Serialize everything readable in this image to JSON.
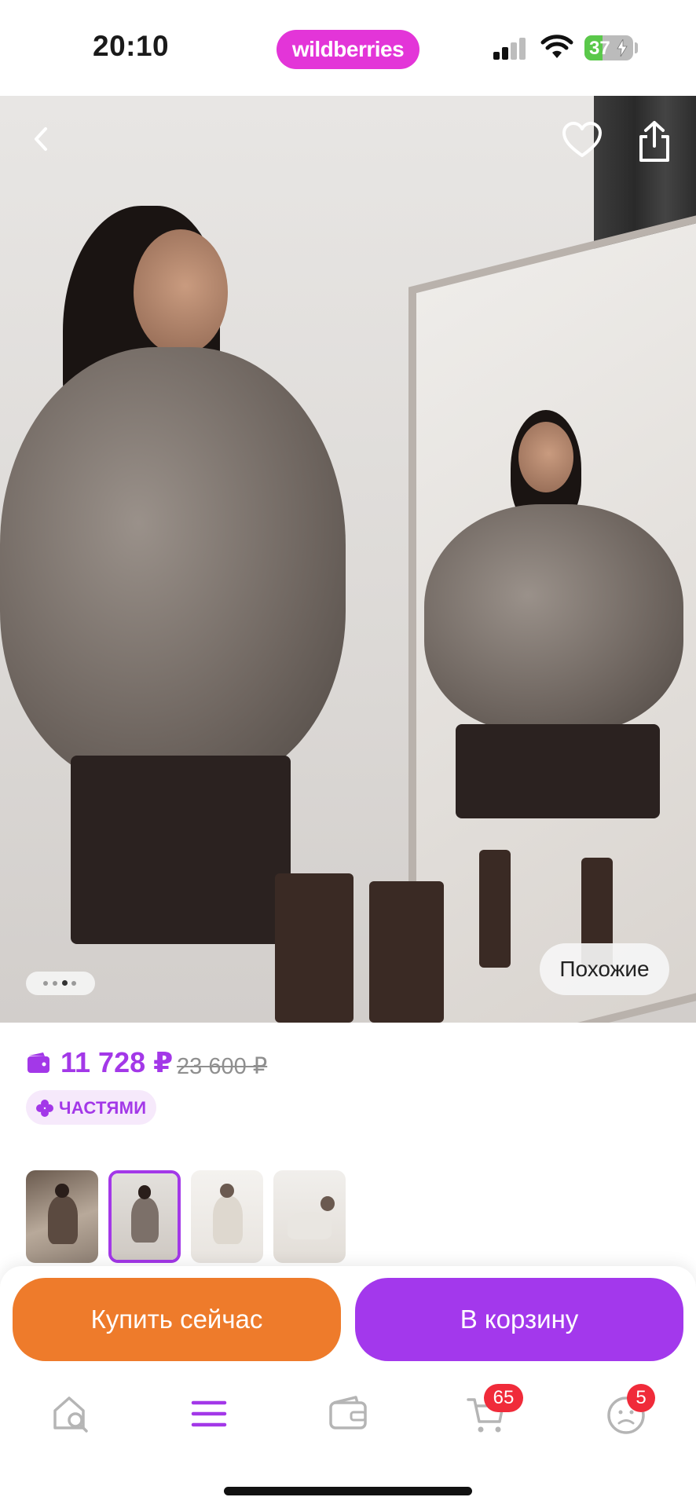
{
  "status_bar": {
    "time": "20:10",
    "brand": "wildberries",
    "battery_percent": "37",
    "battery_level": 0.37,
    "icons": [
      "signal-icon",
      "wifi-icon",
      "battery-charging-icon"
    ]
  },
  "hero": {
    "similar_label": "Похожие",
    "page_count": 4,
    "active_page": 2,
    "icons": [
      "back-icon",
      "heart-icon",
      "share-icon"
    ]
  },
  "product": {
    "price": "11 728 ₽",
    "old_price": "23 600 ₽",
    "installments_label": "ЧАСТЯМИ"
  },
  "thumbnails": {
    "count": 4,
    "selected_index": 1
  },
  "actions": {
    "buy_now": "Купить сейчас",
    "add_to_cart": "В корзину"
  },
  "tab_bar": {
    "items": [
      {
        "icon": "home-search-icon"
      },
      {
        "icon": "menu-icon",
        "active": true
      },
      {
        "icon": "wallet-icon"
      },
      {
        "icon": "cart-icon",
        "badge": "65"
      },
      {
        "icon": "profile-icon",
        "badge": "5"
      }
    ]
  },
  "colors": {
    "accent": "#a338e8",
    "brand_pink": "#e335d8",
    "buy_orange": "#ee7b2b",
    "badge_red": "#f02b3a"
  }
}
